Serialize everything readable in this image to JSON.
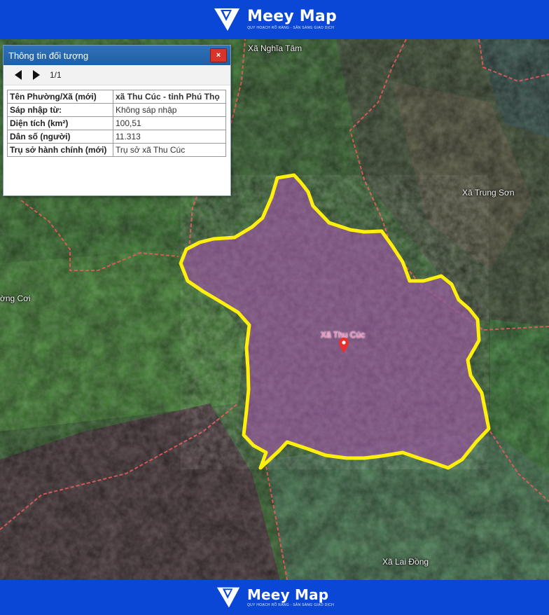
{
  "brand": {
    "name": "Meey Map",
    "tagline": "QUY HOẠCH RÕ RÀNG - SẴN SÀNG GIAO DỊCH",
    "color": "#0b47d6"
  },
  "map": {
    "labels": {
      "nghia_tam": "Xã Nghĩa Tâm",
      "trung_son": "Xã Trung Sơn",
      "vong_coi": "ờng Cơi",
      "lai_dong": "Xã Lai Đồng",
      "selected": "Xã Thu Cúc"
    },
    "highlight_fill": "#8a4f8f",
    "highlight_border": "#ffee00",
    "admin_border": "#e45a5a"
  },
  "panel": {
    "title": "Thông tin đối tượng",
    "close_label": "×",
    "page": "1/1",
    "rows": [
      {
        "key": "Tên Phường/Xã (mới)",
        "value": "xã Thu Cúc - tỉnh Phú Thọ",
        "bold": true
      },
      {
        "key": "Sáp nhập từ:",
        "value": "Không sáp nhập",
        "bold": false
      },
      {
        "key": "Diện tích (km²)",
        "value": "100,51",
        "bold": false
      },
      {
        "key": "Dân số (người)",
        "value": "11.313",
        "bold": false
      },
      {
        "key": "Trụ sở hành chính (mới)",
        "value": "Trụ sở xã Thu Cúc",
        "bold": false
      }
    ]
  }
}
